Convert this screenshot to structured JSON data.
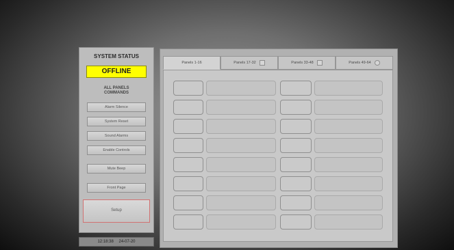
{
  "sidebar": {
    "title": "SYSTEM STATUS",
    "status": "OFFLINE",
    "commands_label_line1": "ALL PANELS",
    "commands_label_line2": "COMMANDS",
    "buttons": [
      {
        "label": "Alarm Silence"
      },
      {
        "label": "System Reset"
      },
      {
        "label": "Sound Alarms"
      },
      {
        "label": "Enable Controls"
      },
      {
        "label": "Mute Beep"
      },
      {
        "label": "Front Page"
      }
    ],
    "setup_label": "Setup"
  },
  "clock": {
    "time": "12:18:38",
    "date": "24-07-20"
  },
  "tabs": [
    {
      "label": "Panels 1-16"
    },
    {
      "label": "Panels 17-32"
    },
    {
      "label": "Panels 33-48"
    },
    {
      "label": "Panels 49-64"
    }
  ],
  "grid": {
    "left_column": [
      "",
      "",
      "",
      "",
      "",
      "",
      "",
      ""
    ],
    "right_column": [
      "",
      "",
      "",
      "",
      "",
      "",
      "",
      ""
    ]
  }
}
